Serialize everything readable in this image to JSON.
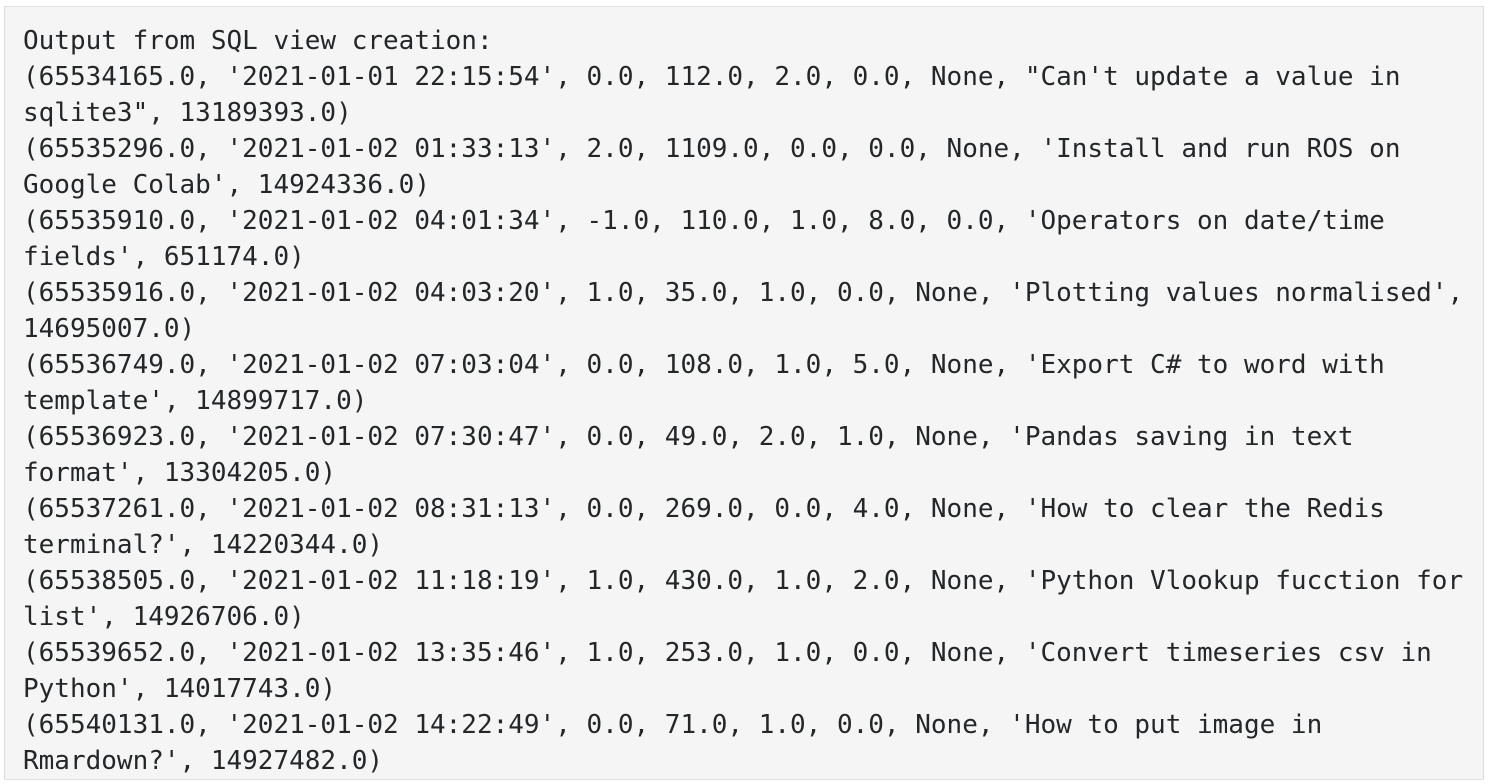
{
  "code_block": {
    "lines": [
      "Output from SQL view creation:",
      "(65534165.0, '2021-01-01 22:15:54', 0.0, 112.0, 2.0, 0.0, None, \"Can't update a value in",
      "sqlite3\", 13189393.0)",
      "(65535296.0, '2021-01-02 01:33:13', 2.0, 1109.0, 0.0, 0.0, None, 'Install and run ROS on",
      "Google Colab', 14924336.0)",
      "(65535910.0, '2021-01-02 04:01:34', -1.0, 110.0, 1.0, 8.0, 0.0, 'Operators on date/time",
      "fields', 651174.0)",
      "(65535916.0, '2021-01-02 04:03:20', 1.0, 35.0, 1.0, 0.0, None, 'Plotting values normalised',",
      "14695007.0)",
      "(65536749.0, '2021-01-02 07:03:04', 0.0, 108.0, 1.0, 5.0, None, 'Export C# to word with",
      "template', 14899717.0)",
      "(65536923.0, '2021-01-02 07:30:47', 0.0, 49.0, 2.0, 1.0, None, 'Pandas saving in text",
      "format', 13304205.0)",
      "(65537261.0, '2021-01-02 08:31:13', 0.0, 269.0, 0.0, 4.0, None, 'How to clear the Redis",
      "terminal?', 14220344.0)",
      "(65538505.0, '2021-01-02 11:18:19', 1.0, 430.0, 1.0, 2.0, None, 'Python Vlookup fucction for",
      "list', 14926706.0)",
      "(65539652.0, '2021-01-02 13:35:46', 1.0, 253.0, 1.0, 0.0, None, 'Convert timeseries csv in",
      "Python', 14017743.0)",
      "(65540131.0, '2021-01-02 14:22:49', 0.0, 71.0, 1.0, 0.0, None, 'How to put image in",
      "Rmardown?', 14927482.0)"
    ]
  }
}
